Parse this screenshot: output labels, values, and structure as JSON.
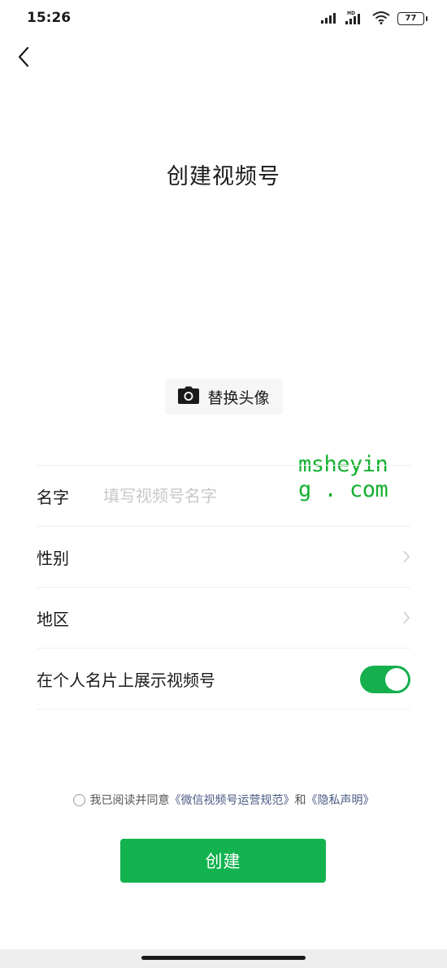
{
  "status_bar": {
    "time": "15:26",
    "battery": "77"
  },
  "header": {
    "back_icon": "chevron-left-icon",
    "title": "创建视频号"
  },
  "avatar": {
    "icon": "camera-icon",
    "label": "替换头像"
  },
  "watermark": "msheying . com",
  "form": {
    "name_label": "名字",
    "name_placeholder": "填写视频号名字",
    "name_value": "",
    "gender_label": "性别",
    "region_label": "地区",
    "show_on_card_label": "在个人名片上展示视频号",
    "show_on_card_enabled": true
  },
  "agreement": {
    "prefix": "我已阅读并同意",
    "link1": "《微信视频号运营规范》",
    "conjunction": "和",
    "link2": "《隐私声明》"
  },
  "create_button": "创建",
  "colors": {
    "accent_green": "#12b34f",
    "link_blue": "#4a5a84",
    "watermark_green": "#13b030"
  }
}
